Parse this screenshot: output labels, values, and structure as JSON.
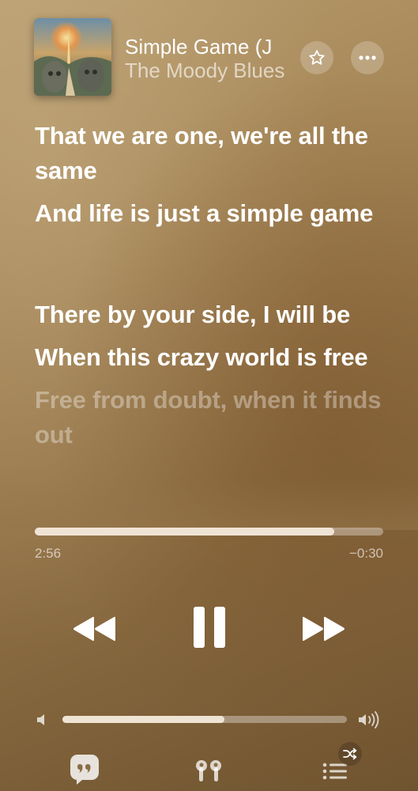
{
  "now_playing": {
    "title": "Simple Game (J",
    "artist": "The Moody Blues",
    "artwork_icon": "album-artwork"
  },
  "header_buttons": {
    "favorite_icon": "star-icon",
    "more_icon": "ellipsis-icon"
  },
  "lyrics": {
    "lines": [
      {
        "text": "That we are one, we're all the same",
        "state": "active"
      },
      {
        "text": "And life is just a simple game",
        "state": "active"
      },
      {
        "text": "There by your side, I will be",
        "state": "active"
      },
      {
        "text": "When this crazy world is free",
        "state": "active"
      },
      {
        "text": "Free from doubt, when it finds out",
        "state": "upcoming"
      }
    ]
  },
  "progress": {
    "elapsed": "2:56",
    "remaining": "−0:30",
    "fraction": 0.86
  },
  "controls": {
    "rewind_icon": "rewind-icon",
    "pause_icon": "pause-icon",
    "forward_icon": "fast-forward-icon"
  },
  "volume": {
    "fraction": 0.57,
    "low_icon": "speaker-low-icon",
    "high_icon": "speaker-high-icon"
  },
  "bottom_bar": {
    "lyrics_icon": "lyrics-quote-icon",
    "airplay_icon": "airpods-icon",
    "queue_icon": "queue-list-icon",
    "shuffle_icon": "shuffle-icon"
  },
  "colors": {
    "background": "#a58556",
    "fill": "#efe4d4"
  }
}
